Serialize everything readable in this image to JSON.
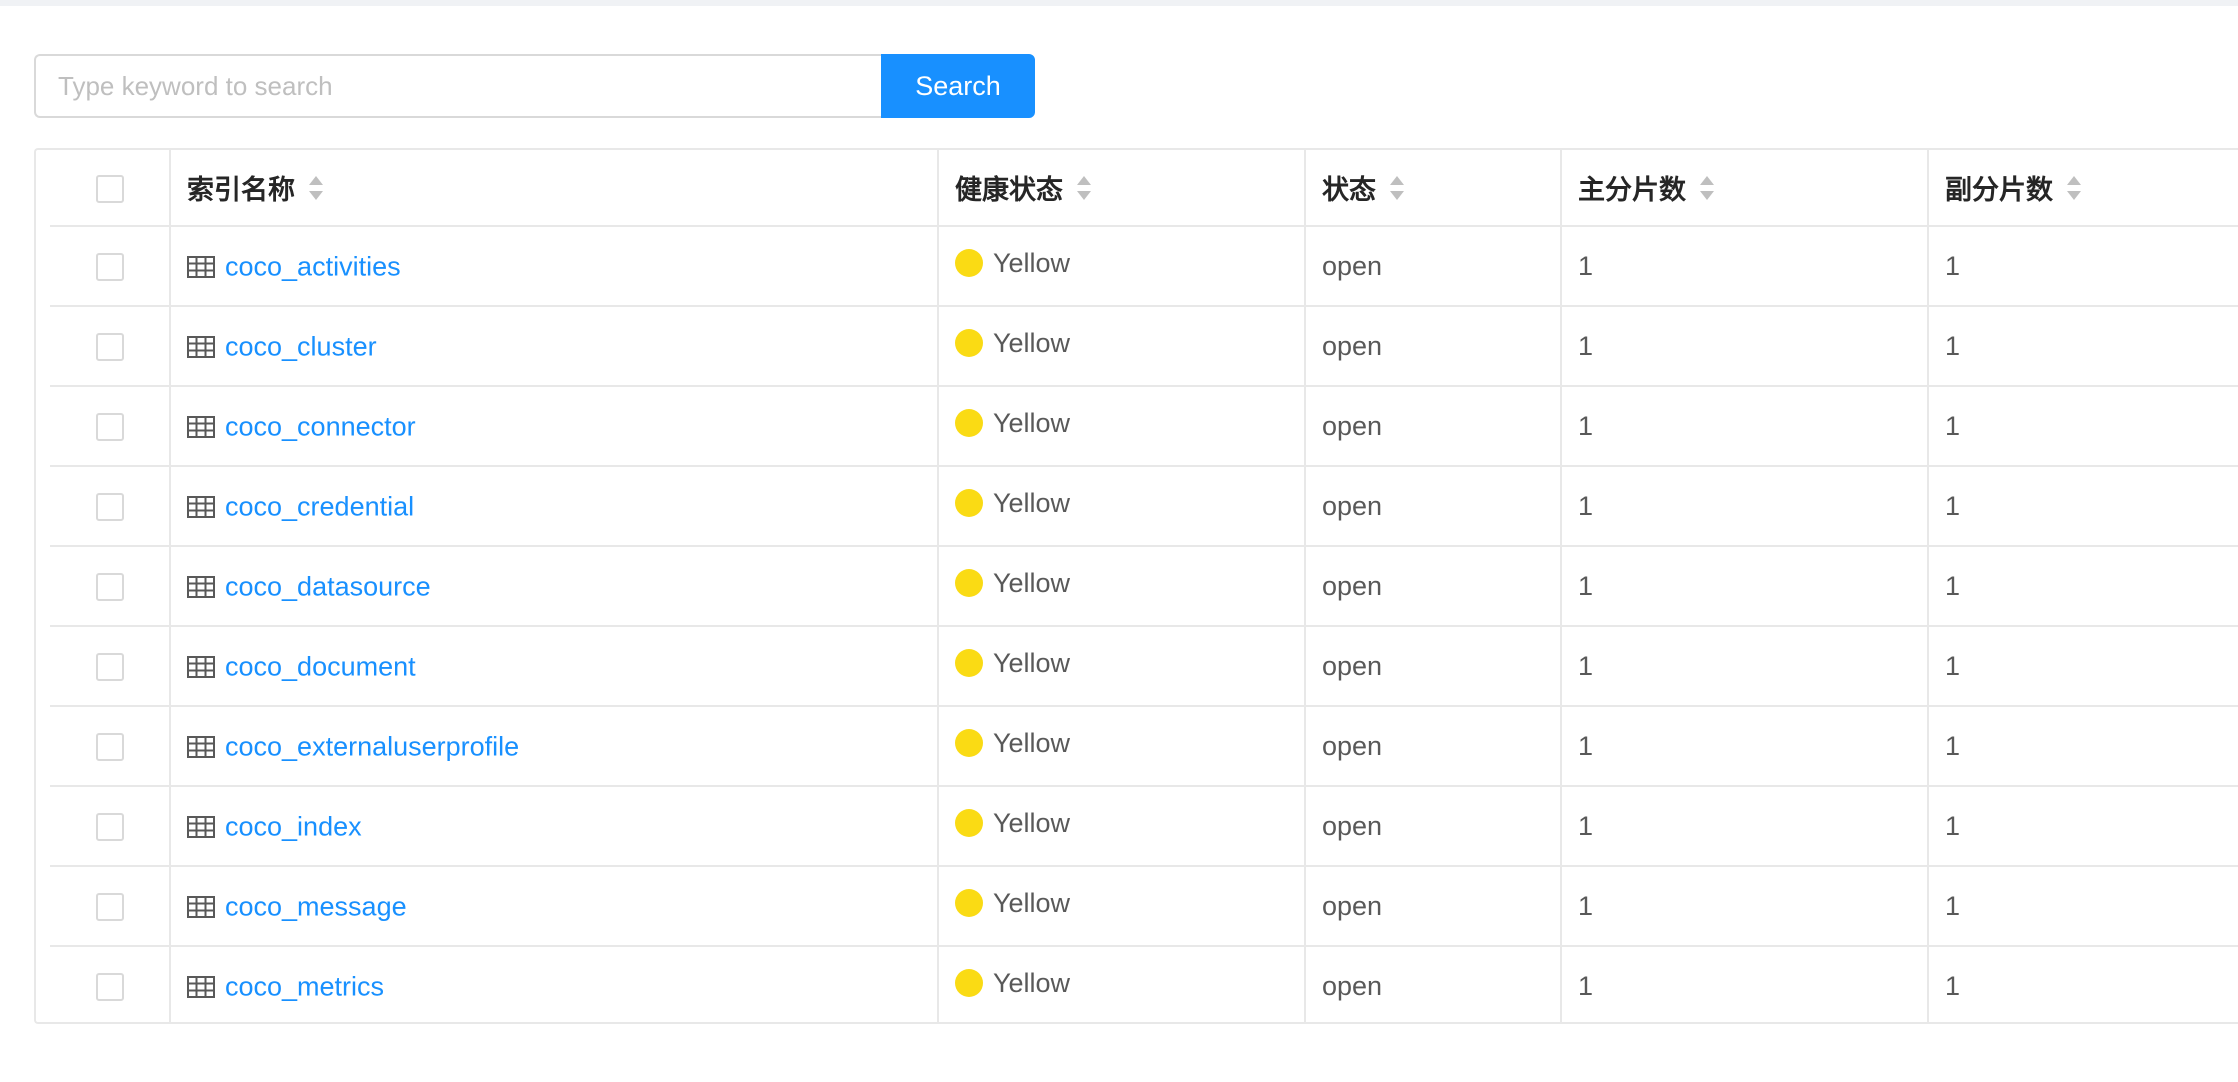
{
  "search": {
    "placeholder": "Type keyword to search",
    "value": "",
    "button_label": "Search"
  },
  "colors": {
    "accent": "#1890ff",
    "yellow_status": "#fadb14"
  },
  "table": {
    "columns": [
      "索引名称",
      "健康状态",
      "状态",
      "主分片数",
      "副分片数"
    ],
    "rows": [
      {
        "name": "coco_activities",
        "health": "Yellow",
        "status": "open",
        "primary": "1",
        "replica": "1"
      },
      {
        "name": "coco_cluster",
        "health": "Yellow",
        "status": "open",
        "primary": "1",
        "replica": "1"
      },
      {
        "name": "coco_connector",
        "health": "Yellow",
        "status": "open",
        "primary": "1",
        "replica": "1"
      },
      {
        "name": "coco_credential",
        "health": "Yellow",
        "status": "open",
        "primary": "1",
        "replica": "1"
      },
      {
        "name": "coco_datasource",
        "health": "Yellow",
        "status": "open",
        "primary": "1",
        "replica": "1"
      },
      {
        "name": "coco_document",
        "health": "Yellow",
        "status": "open",
        "primary": "1",
        "replica": "1"
      },
      {
        "name": "coco_externaluserprofile",
        "health": "Yellow",
        "status": "open",
        "primary": "1",
        "replica": "1"
      },
      {
        "name": "coco_index",
        "health": "Yellow",
        "status": "open",
        "primary": "1",
        "replica": "1"
      },
      {
        "name": "coco_message",
        "health": "Yellow",
        "status": "open",
        "primary": "1",
        "replica": "1"
      },
      {
        "name": "coco_metrics",
        "health": "Yellow",
        "status": "open",
        "primary": "1",
        "replica": "1"
      }
    ]
  },
  "icons": {
    "row_icon": "table-icon",
    "sort_icon": "sort-icon",
    "health_icon": "status-dot-icon"
  }
}
